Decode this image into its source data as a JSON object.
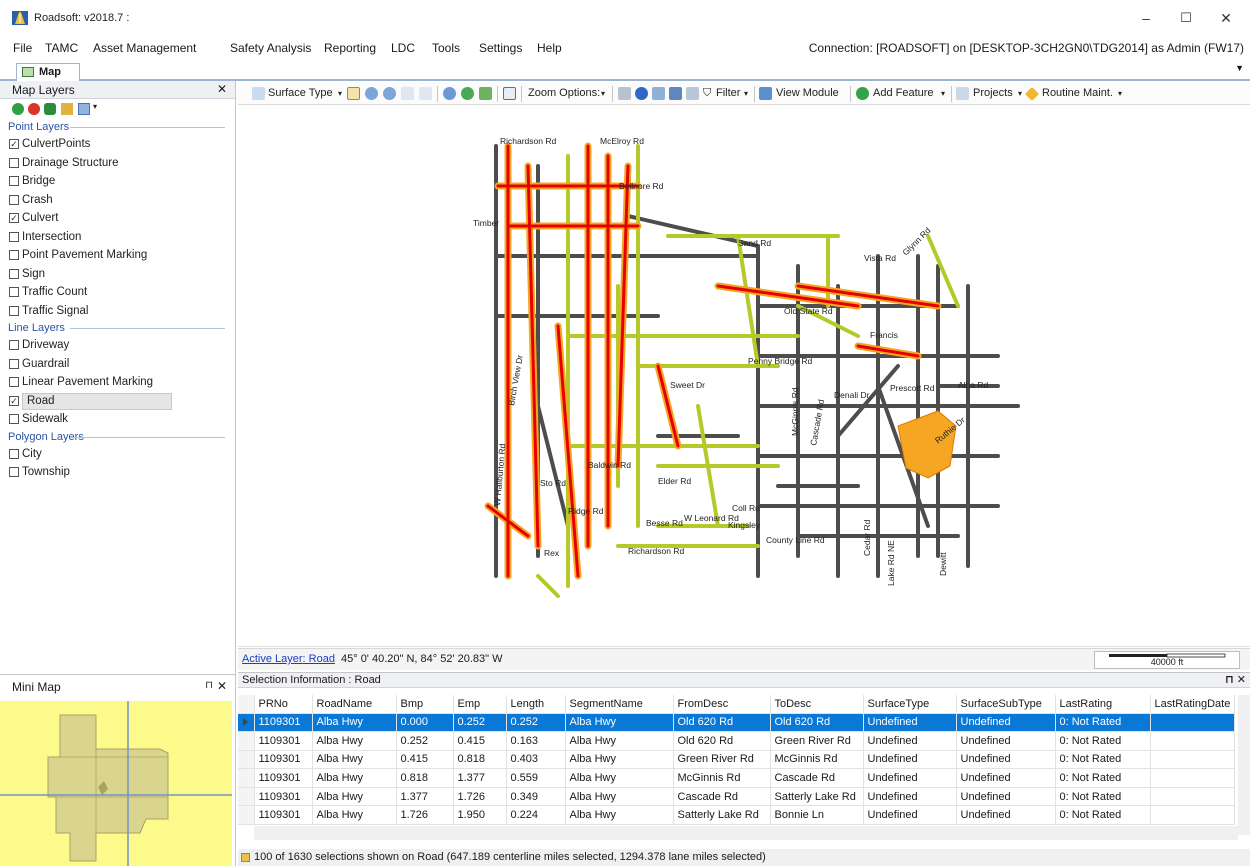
{
  "window": {
    "title": "Roadsoft: v2018.7 :"
  },
  "menu": {
    "items": [
      "File",
      "TAMC",
      "Asset Management",
      "Safety Analysis",
      "Reporting",
      "LDC",
      "Tools",
      "Settings",
      "Help"
    ],
    "connection": "Connection: [ROADSOFT] on [DESKTOP-3CH2GN0\\TDG2014] as Admin (FW17)"
  },
  "doc_tab": {
    "label": "Map"
  },
  "layers_panel": {
    "title": "Map Layers",
    "groups": [
      {
        "title": "Point Layers",
        "items": [
          {
            "label": "CulvertPoints",
            "checked": true
          },
          {
            "label": "Drainage Structure",
            "checked": false
          },
          {
            "label": "Bridge",
            "checked": false
          },
          {
            "label": "Crash",
            "checked": false
          },
          {
            "label": "Culvert",
            "checked": true
          },
          {
            "label": "Intersection",
            "checked": false
          },
          {
            "label": "Point Pavement Marking",
            "checked": false
          },
          {
            "label": "Sign",
            "checked": false
          },
          {
            "label": "Traffic Count",
            "checked": false
          },
          {
            "label": "Traffic Signal",
            "checked": false
          }
        ]
      },
      {
        "title": "Line Layers",
        "items": [
          {
            "label": "Driveway",
            "checked": false
          },
          {
            "label": "Guardrail",
            "checked": false
          },
          {
            "label": "Linear Pavement Marking",
            "checked": false
          },
          {
            "label": "Road",
            "checked": true,
            "selected": true
          },
          {
            "label": "Sidewalk",
            "checked": false
          }
        ]
      },
      {
        "title": "Polygon Layers",
        "items": [
          {
            "label": "City",
            "checked": false
          },
          {
            "label": "Township",
            "checked": false
          }
        ]
      }
    ]
  },
  "mini_map": {
    "title": "Mini Map",
    "colors": {
      "bg": "#fdfa8c",
      "county": "#d8d48a",
      "line": "#6a8fc8"
    }
  },
  "map_toolbar": {
    "surface_type": "Surface Type",
    "zoom_options": "Zoom Options:",
    "filter": "Filter",
    "view_module": "View Module",
    "add_feature": "Add Feature",
    "projects": "Projects",
    "routine_maint": "Routine Maint."
  },
  "map": {
    "road_colors": {
      "rated_poor": "#e60000",
      "rated_fair": "#f5a623",
      "rated_good": "#b5c92a",
      "unrated": "#4d4d4d"
    },
    "labels": [
      "Richardson Rd",
      "McElroy Rd",
      "Timber",
      "Sand Rd",
      "Birch View Dr",
      "Sto Rd",
      "W Haliburton Rd",
      "Rex",
      "Richardson Rd",
      "Besse Rd",
      "W Leonard Rd",
      "Kingsley",
      "County Line Rd",
      "Cedar Rd",
      "Lake Rd NE",
      "Dewitt",
      "Alba Rd",
      "Glynn Rd",
      "Vista Rd",
      "Francis",
      "Old State Rd",
      "Penny Bridge Rd",
      "Prescott Rd",
      "McGinnis Rd",
      "Denali Dr",
      "Cascade Rd",
      "Elder Rd",
      "Baldwin Rd",
      "Coll Rd",
      "Ruthie Dr",
      "Ridge Rd",
      "Bellnore Rd",
      "Sweet Dr"
    ]
  },
  "status": {
    "active_layer": "Active Layer: Road",
    "coords": "45° 0' 40.20\" N, 84° 52' 20.83\" W",
    "scale": "40000 ft"
  },
  "selection": {
    "title": "Selection Information : Road",
    "columns": [
      "PRNo",
      "RoadName",
      "Bmp",
      "Emp",
      "Length",
      "SegmentName",
      "FromDesc",
      "ToDesc",
      "SurfaceType",
      "SurfaceSubType",
      "LastRating",
      "LastRatingDate"
    ],
    "rows": [
      [
        "1109301",
        "Alba Hwy",
        "0.000",
        "0.252",
        "0.252",
        "Alba Hwy",
        "Old 620 Rd",
        "Old 620 Rd",
        "Undefined",
        "Undefined",
        "0: Not Rated",
        ""
      ],
      [
        "1109301",
        "Alba Hwy",
        "0.252",
        "0.415",
        "0.163",
        "Alba Hwy",
        "Old 620 Rd",
        "Green River Rd",
        "Undefined",
        "Undefined",
        "0: Not Rated",
        ""
      ],
      [
        "1109301",
        "Alba Hwy",
        "0.415",
        "0.818",
        "0.403",
        "Alba Hwy",
        "Green River Rd",
        "McGinnis Rd",
        "Undefined",
        "Undefined",
        "0: Not Rated",
        ""
      ],
      [
        "1109301",
        "Alba Hwy",
        "0.818",
        "1.377",
        "0.559",
        "Alba Hwy",
        "McGinnis Rd",
        "Cascade Rd",
        "Undefined",
        "Undefined",
        "0: Not Rated",
        ""
      ],
      [
        "1109301",
        "Alba Hwy",
        "1.377",
        "1.726",
        "0.349",
        "Alba Hwy",
        "Cascade Rd",
        "Satterly Lake Rd",
        "Undefined",
        "Undefined",
        "0: Not Rated",
        ""
      ],
      [
        "1109301",
        "Alba Hwy",
        "1.726",
        "1.950",
        "0.224",
        "Alba Hwy",
        "Satterly Lake Rd",
        "Bonnie Ln",
        "Undefined",
        "Undefined",
        "0: Not Rated",
        ""
      ]
    ],
    "selected_row": 0
  },
  "footer": {
    "text": "100 of 1630 selections shown on Road (647.189 centerline miles selected, 1294.378 lane miles selected)"
  }
}
